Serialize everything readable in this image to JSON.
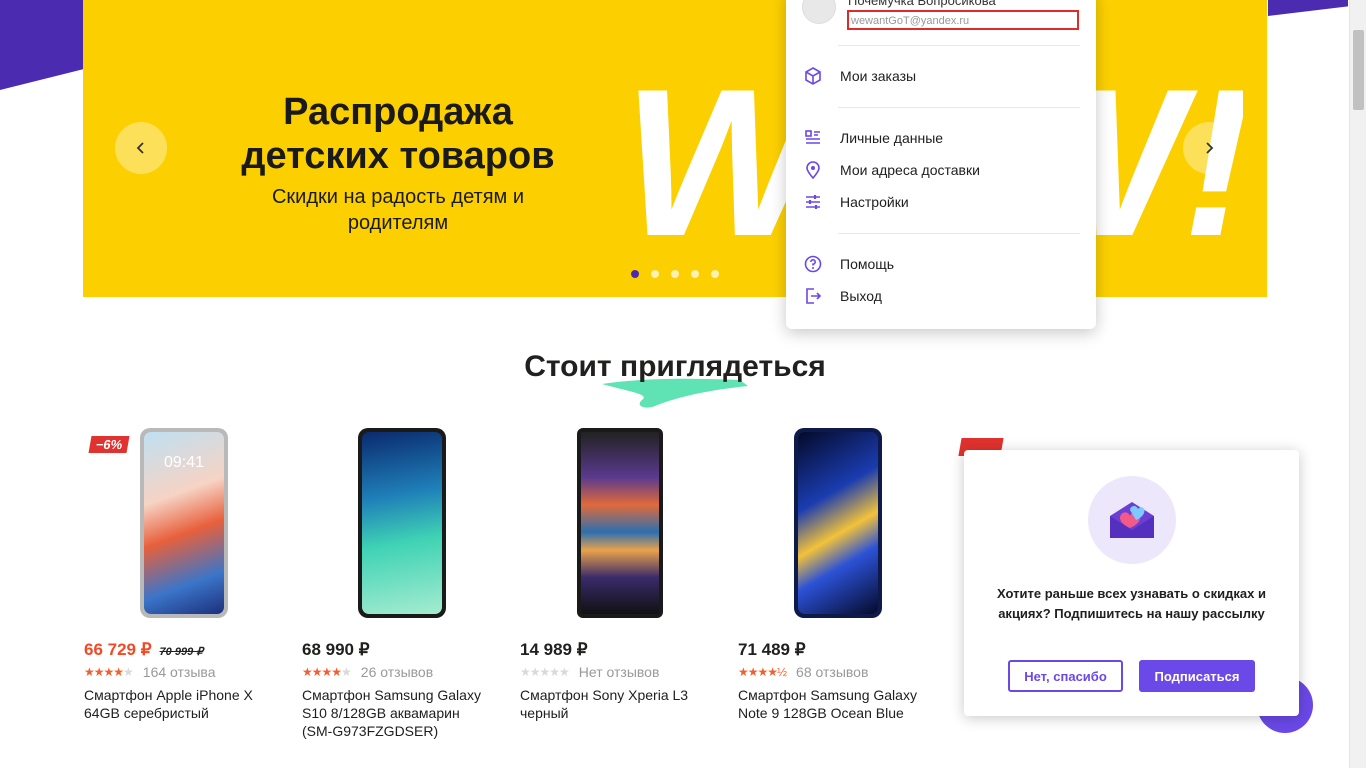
{
  "banner": {
    "title": "Распродажа детских товаров",
    "subtitle": "Скидки на радость детям и родителям",
    "art_text": "WOW!",
    "dots_count": 5,
    "active_dot": 1
  },
  "user_menu": {
    "name": "Почемучка Вопросикова",
    "email": "wewantGoT@yandex.ru",
    "items": [
      {
        "label": "Мои заказы",
        "icon": "box-icon"
      },
      {
        "label": "Личные данные",
        "icon": "profile-list-icon"
      },
      {
        "label": "Мои адреса доставки",
        "icon": "location-pin-icon"
      },
      {
        "label": "Настройки",
        "icon": "sliders-icon"
      },
      {
        "label": "Помощь",
        "icon": "question-icon"
      },
      {
        "label": "Выход",
        "icon": "logout-icon"
      }
    ]
  },
  "section": {
    "title": "Стоит приглядеться"
  },
  "products": [
    {
      "name": "Смартфон Apple iPhone X 64GB серебристый",
      "price": "66 729 ₽",
      "old_price": "70 999 ₽",
      "badge": "−6%",
      "reviews": "164 отзыва",
      "rating": 4,
      "time": "09:41"
    },
    {
      "name": "Смартфон Samsung Galaxy S10 8/128GB аквамарин (SM-G973FZGDSER)",
      "price": "68 990 ₽",
      "reviews": "26 отзывов",
      "rating": 4
    },
    {
      "name": "Смартфон Sony Xperia L3 черный",
      "price": "14 989 ₽",
      "reviews": "Нет отзывов",
      "rating": 0
    },
    {
      "name": "Смартфон Samsung Galaxy Note 9 128GB Ocean Blue",
      "price": "71 489 ₽",
      "reviews": "68 отзывов",
      "rating": 4.5
    }
  ],
  "popup": {
    "text": "Хотите раньше всех узнавать о скидках и акциях? Подпишитесь на нашу рассылку",
    "decline_label": "Нет, спасибо",
    "accept_label": "Подписаться"
  },
  "colors": {
    "banner_yellow": "#fcd000",
    "accent_purple": "#6b48e8",
    "brand_dark_purple": "#4b2bb0",
    "sale_red": "#f04a26"
  }
}
